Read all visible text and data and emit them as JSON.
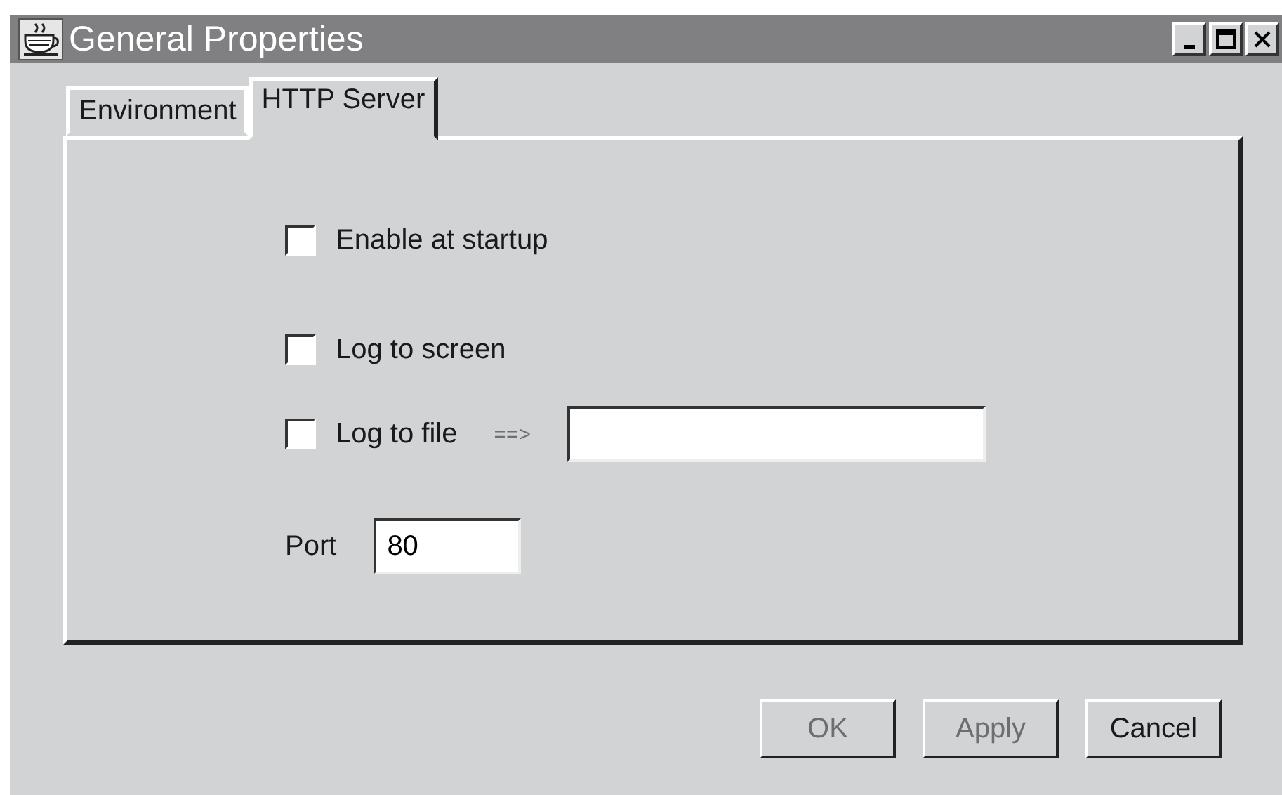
{
  "window": {
    "title": "General Properties"
  },
  "tabs": [
    {
      "label": "Environment",
      "selected": false
    },
    {
      "label": "HTTP Server",
      "selected": true
    }
  ],
  "options": [
    {
      "kind": "checkbox",
      "label": "Enable at startup",
      "checked": false
    },
    {
      "kind": "checkbox",
      "label": "Log to screen",
      "checked": false
    },
    {
      "kind": "checkbox-file",
      "label": "Log to file",
      "checked": false,
      "arrow": "==>"
    },
    {
      "kind": "port",
      "label": "Port",
      "value": "80"
    }
  ],
  "buttons": [
    {
      "label": "OK",
      "disabled": true
    },
    {
      "label": "Apply",
      "disabled": true
    },
    {
      "label": "Cancel",
      "disabled": false
    }
  ]
}
